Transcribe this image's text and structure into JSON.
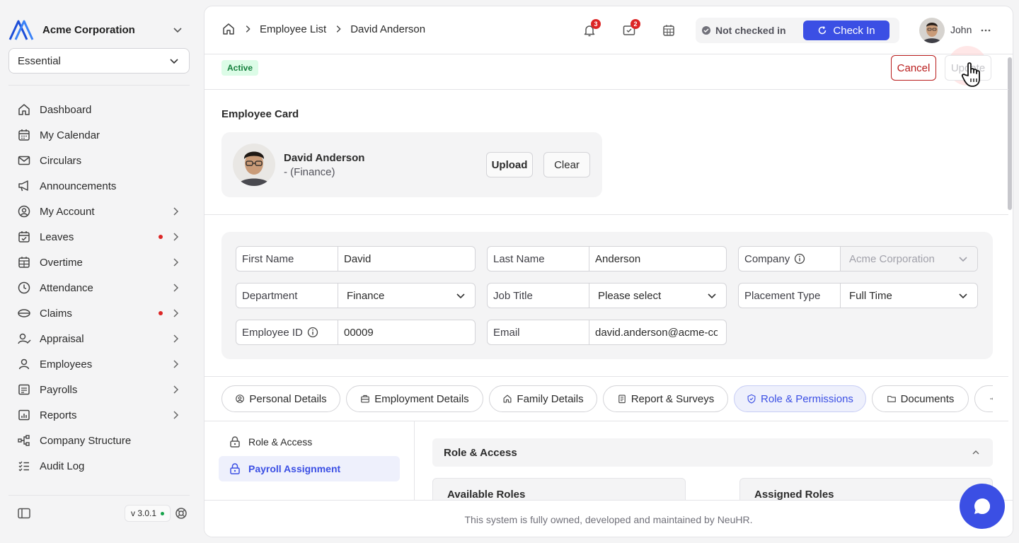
{
  "sidebar": {
    "org_name": "Acme Corporation",
    "plan": "Essential",
    "items": [
      {
        "label": "Dashboard",
        "icon": "home-icon"
      },
      {
        "label": "My Calendar",
        "icon": "calendar-icon"
      },
      {
        "label": "Circulars",
        "icon": "mail-icon"
      },
      {
        "label": "Announcements",
        "icon": "megaphone-icon"
      },
      {
        "label": "My Account",
        "icon": "user-circle-icon"
      },
      {
        "label": "Leaves",
        "icon": "calendar-check-icon"
      },
      {
        "label": "Overtime",
        "icon": "calendar-grid-icon"
      },
      {
        "label": "Attendance",
        "icon": "clock-icon"
      },
      {
        "label": "Claims",
        "icon": "wallet-icon"
      },
      {
        "label": "Appraisal",
        "icon": "user-check-icon"
      },
      {
        "label": "Employees",
        "icon": "user-icon"
      },
      {
        "label": "Payrolls",
        "icon": "payroll-icon"
      },
      {
        "label": "Reports",
        "icon": "report-icon"
      },
      {
        "label": "Company Structure",
        "icon": "org-chart-icon"
      },
      {
        "label": "Audit Log",
        "icon": "checklist-icon"
      }
    ],
    "version": "v 3.0.1"
  },
  "header": {
    "breadcrumb": [
      "Employee List",
      "David Anderson"
    ],
    "notif_count": "3",
    "inbox_count": "2",
    "checkin_status": "Not checked in",
    "checkin_label": "Check In",
    "user_name": "John"
  },
  "profile": {
    "status": "Active",
    "cancel_label": "Cancel",
    "update_label": "Update",
    "card_title": "Employee Card",
    "name": "David Anderson",
    "dept_line": "- (Finance)",
    "upload_label": "Upload",
    "clear_label": "Clear"
  },
  "form": {
    "first_name": {
      "label": "First Name",
      "value": "David"
    },
    "last_name": {
      "label": "Last Name",
      "value": "Anderson"
    },
    "company": {
      "label": "Company",
      "value": "Acme Corporation"
    },
    "department": {
      "label": "Department",
      "value": "Finance"
    },
    "job_title": {
      "label": "Job Title",
      "value": "Please select"
    },
    "placement": {
      "label": "Placement Type",
      "value": "Full Time"
    },
    "employee_id": {
      "label": "Employee ID",
      "value": "00009"
    },
    "email": {
      "label": "Email",
      "value": "david.anderson@acme-corp.com"
    }
  },
  "tabs": [
    {
      "label": "Personal Details",
      "icon": "user-circle-icon"
    },
    {
      "label": "Employment Details",
      "icon": "briefcase-icon"
    },
    {
      "label": "Family Details",
      "icon": "home-icon"
    },
    {
      "label": "Report & Surveys",
      "icon": "clipboard-icon"
    },
    {
      "label": "Role & Permissions",
      "icon": "shield-check-icon",
      "active": true
    },
    {
      "label": "Documents",
      "icon": "folder-icon"
    }
  ],
  "subnav": [
    {
      "label": "Role & Access",
      "icon": "lock-icon"
    },
    {
      "label": "Payroll Assignment",
      "icon": "lock-icon",
      "active": true
    }
  ],
  "section": {
    "title": "Role & Access",
    "available_roles": "Available Roles",
    "assigned_roles": "Assigned Roles"
  },
  "footer": {
    "text": "This system is fully owned, developed and maintained by NeuHR."
  },
  "colors": {
    "accent": "#3b4fe4",
    "danger": "#b91c1c",
    "success": "#15803d"
  }
}
